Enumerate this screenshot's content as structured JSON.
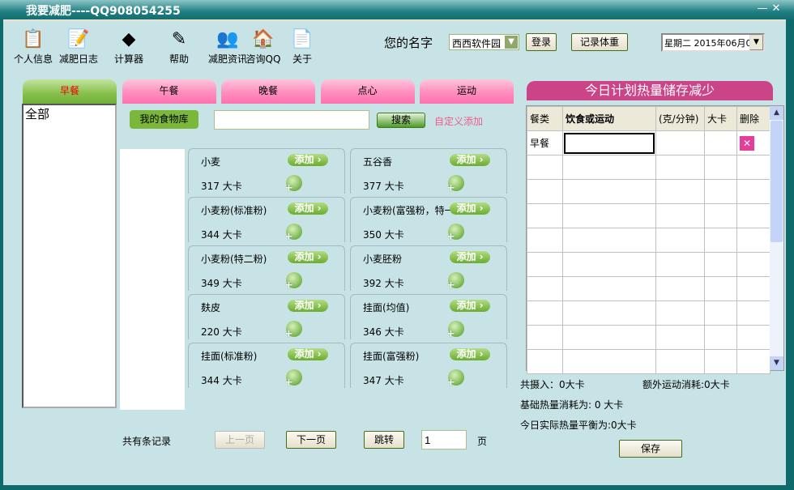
{
  "window": {
    "title": "我要减肥----QQ908054255",
    "minimize": "—",
    "close": "✕"
  },
  "toolbar": [
    {
      "label": "个人信息",
      "icon": "person-info-icon",
      "glyph": "📋"
    },
    {
      "label": "减肥日志",
      "icon": "diary-icon",
      "glyph": "📝"
    },
    {
      "label": "计算器",
      "icon": "calculator-icon",
      "glyph": "◆"
    },
    {
      "label": "帮助",
      "icon": "help-icon",
      "glyph": "✎"
    },
    {
      "label": "减肥资讯",
      "icon": "news-icon",
      "glyph": "👥"
    },
    {
      "label": "咨询QQ",
      "icon": "house-icon",
      "glyph": "🏠"
    },
    {
      "label": "关于",
      "icon": "about-icon",
      "glyph": "📄"
    }
  ],
  "user": {
    "name_label": "您的名字",
    "name_value": "西西软件园",
    "login": "登录",
    "record_weight": "记录体重",
    "date": "星期二 2015年06月0"
  },
  "tabs": [
    "早餐",
    "午餐",
    "晚餐",
    "点心",
    "运动"
  ],
  "category_list": [
    "全部"
  ],
  "search": {
    "my_food": "我的食物库",
    "value": "",
    "search_btn": "搜索",
    "custom_add": "自定义添加"
  },
  "foods": [
    {
      "name": "小麦",
      "kcal": "317 大卡"
    },
    {
      "name": "五谷香",
      "kcal": "377 大卡"
    },
    {
      "name": "小麦粉(标准粉)",
      "kcal": "344 大卡"
    },
    {
      "name": "小麦粉(富强粉，特一粉)",
      "kcal": "350 大卡"
    },
    {
      "name": "小麦粉(特二粉)",
      "kcal": "349 大卡"
    },
    {
      "name": "小麦胚粉",
      "kcal": "392 大卡"
    },
    {
      "name": "麸皮",
      "kcal": "220 大卡"
    },
    {
      "name": "挂面(均值)",
      "kcal": "346 大卡"
    },
    {
      "name": "挂面(标准粉)",
      "kcal": "344 大卡"
    },
    {
      "name": "挂面(富强粉)",
      "kcal": "347 大卡"
    }
  ],
  "add_label": "添加 ›",
  "pager": {
    "total": "共有条记录",
    "prev": "上一页",
    "next": "下一页",
    "jump": "跳转",
    "page": "1",
    "page_unit": "页"
  },
  "plan": {
    "title": "今日计划热量储存减少",
    "columns": [
      "餐类",
      "饮食或运动",
      "(克/分钟)",
      "大卡",
      "删除"
    ],
    "rows": [
      {
        "meal": "早餐",
        "item": "",
        "amount": "",
        "kcal": ""
      }
    ]
  },
  "stats": {
    "intake": "共摄入：0大卡",
    "extra": "额外运动消耗:0大卡",
    "base": "基础热量消耗为: 0 大卡",
    "balance": "今日实际热量平衡为:0大卡"
  },
  "save": "保存"
}
